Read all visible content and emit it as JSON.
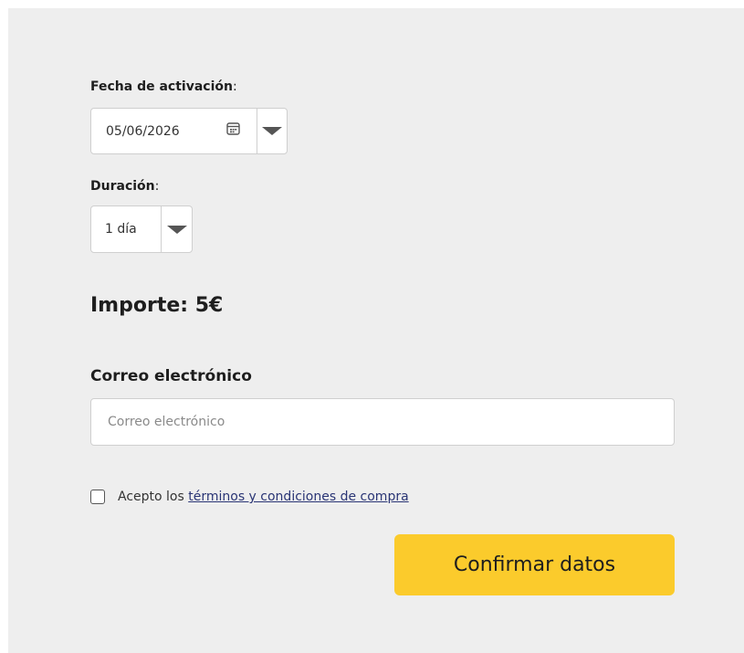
{
  "form": {
    "activation_date": {
      "label": "Fecha de activación",
      "colon": ":",
      "value": "05/06/2026",
      "calendar_icon": "calendar-icon",
      "dropdown_icon": "caret-down-icon"
    },
    "duration": {
      "label": "Duración",
      "colon": ":",
      "value": "1 día",
      "dropdown_icon": "caret-down-icon"
    },
    "amount": "Importe: 5€",
    "email": {
      "label": "Correo electrónico",
      "placeholder": "Correo electrónico",
      "value": ""
    },
    "terms": {
      "checked": false,
      "prefix": "Acepto los ",
      "link_text": "términos y condiciones de compra"
    },
    "confirm_label": "Confirmar datos"
  },
  "colors": {
    "panel_background": "#eeeeee",
    "confirm_button": "#fbcb2c",
    "link": "#2a3575",
    "border": "#cfcfcf"
  }
}
